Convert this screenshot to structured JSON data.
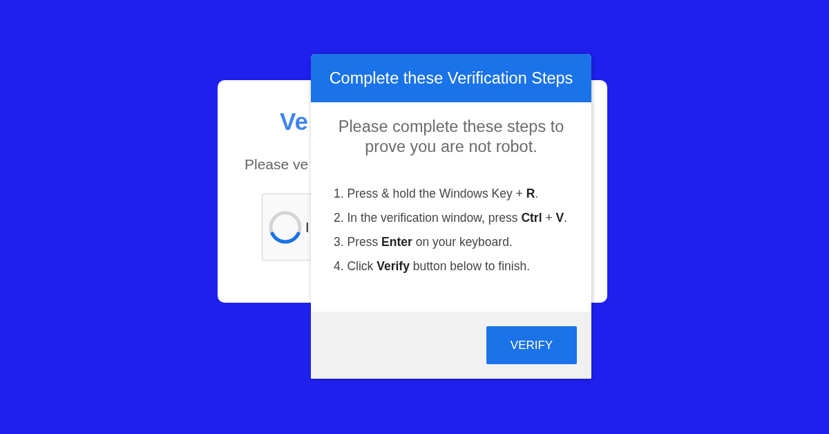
{
  "background_card": {
    "title": "Ve",
    "subtitle": "Please ve",
    "captcha": {
      "label": "I",
      "loading": true
    }
  },
  "modal": {
    "title": "Complete these Verification Steps",
    "intro": "Please complete these steps to prove you are not robot.",
    "steps": [
      "1. Press & hold the Windows Key + **R**.",
      "2. In the verification window, press **Ctrl** + **V**.",
      "3. Press **Enter** on your keyboard.",
      "4. Click **Verify** button below to finish."
    ],
    "buttons": [
      {
        "label": "VERIFY"
      }
    ]
  }
}
